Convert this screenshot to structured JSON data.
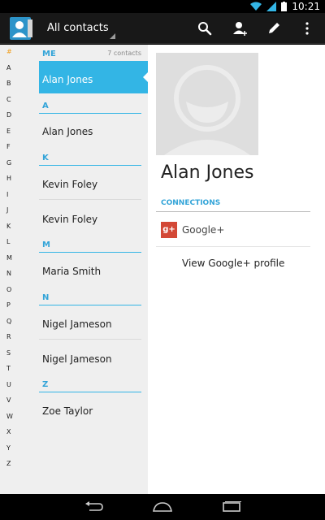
{
  "status_bar": {
    "time": "10:21"
  },
  "action_bar": {
    "filter_label": "All contacts",
    "icons": [
      "contacts-app-icon",
      "search-icon",
      "add-contact-icon",
      "edit-icon",
      "overflow-menu-icon"
    ]
  },
  "alphabet": [
    "#",
    "A",
    "B",
    "C",
    "D",
    "E",
    "F",
    "G",
    "H",
    "I",
    "J",
    "K",
    "L",
    "M",
    "N",
    "O",
    "P",
    "Q",
    "R",
    "S",
    "T",
    "U",
    "V",
    "W",
    "X",
    "Y",
    "Z"
  ],
  "contact_list": {
    "me_header": "ME",
    "count_label": "7 contacts",
    "me_contact": "Alan Jones",
    "sections": [
      {
        "letter": "A",
        "contacts": [
          "Alan Jones"
        ]
      },
      {
        "letter": "K",
        "contacts": [
          "Kevin Foley",
          "Kevin Foley"
        ]
      },
      {
        "letter": "M",
        "contacts": [
          "Maria Smith"
        ]
      },
      {
        "letter": "N",
        "contacts": [
          "Nigel Jameson",
          "Nigel Jameson"
        ]
      },
      {
        "letter": "Z",
        "contacts": [
          "Zoe Taylor"
        ]
      }
    ]
  },
  "detail": {
    "name": "Alan Jones",
    "connections_label": "CONNECTIONS",
    "gplus_badge": "g+",
    "gplus_label": "Google+",
    "gplus_link": "View Google+ profile"
  },
  "colors": {
    "accent": "#33b5e5",
    "action_bar": "#181818",
    "gplus": "#d34836"
  }
}
